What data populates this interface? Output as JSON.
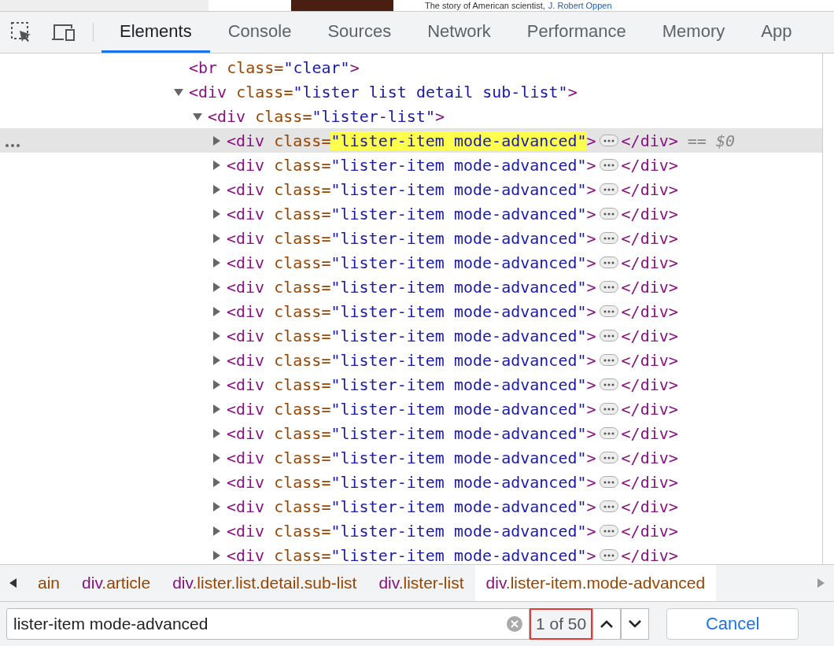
{
  "page_behind": {
    "text": "The story of American scientist,",
    "link": "J. Robert Oppen"
  },
  "tabs": [
    {
      "label": "Elements",
      "selected": true
    },
    {
      "label": "Console",
      "selected": false
    },
    {
      "label": "Sources",
      "selected": false
    },
    {
      "label": "Network",
      "selected": false
    },
    {
      "label": "Performance",
      "selected": false
    },
    {
      "label": "Memory",
      "selected": false
    },
    {
      "label": "App",
      "selected": false
    }
  ],
  "tree": [
    {
      "open": "<br",
      "attr_name": "class=",
      "attr_value": "\"clear\"",
      "tag_end": ">",
      "expanded": false,
      "selected": false,
      "highlighted": false
    },
    {
      "open": "<div",
      "attr_name": "class=",
      "attr_value": "\"lister list detail sub-list\"",
      "tag_end": ">",
      "expanded": true,
      "selected": false,
      "highlighted": false,
      "children": [
        {
          "open": "<div",
          "attr_name": "class=",
          "attr_value": "\"lister-list\"",
          "tag_end": ">",
          "expanded": true,
          "selected": false,
          "highlighted": false,
          "children": [
            {
              "open": "<div",
              "attr_name": "class=",
              "attr_value": "\"lister-item mode-advanced\"",
              "tag_end": ">",
              "close": "</div>",
              "marker": "== $0",
              "expanded": false,
              "selected": true,
              "highlighted": true
            },
            {
              "open": "<div",
              "attr_name": "class=",
              "attr_value": "\"lister-item mode-advanced\"",
              "tag_end": ">",
              "close": "</div>",
              "expanded": false,
              "selected": false,
              "highlighted": false
            },
            {
              "open": "<div",
              "attr_name": "class=",
              "attr_value": "\"lister-item mode-advanced\"",
              "tag_end": ">",
              "close": "</div>",
              "expanded": false,
              "selected": false,
              "highlighted": false
            },
            {
              "open": "<div",
              "attr_name": "class=",
              "attr_value": "\"lister-item mode-advanced\"",
              "tag_end": ">",
              "close": "</div>",
              "expanded": false,
              "selected": false,
              "highlighted": false
            },
            {
              "open": "<div",
              "attr_name": "class=",
              "attr_value": "\"lister-item mode-advanced\"",
              "tag_end": ">",
              "close": "</div>",
              "expanded": false,
              "selected": false,
              "highlighted": false
            },
            {
              "open": "<div",
              "attr_name": "class=",
              "attr_value": "\"lister-item mode-advanced\"",
              "tag_end": ">",
              "close": "</div>",
              "expanded": false,
              "selected": false,
              "highlighted": false
            },
            {
              "open": "<div",
              "attr_name": "class=",
              "attr_value": "\"lister-item mode-advanced\"",
              "tag_end": ">",
              "close": "</div>",
              "expanded": false,
              "selected": false,
              "highlighted": false
            },
            {
              "open": "<div",
              "attr_name": "class=",
              "attr_value": "\"lister-item mode-advanced\"",
              "tag_end": ">",
              "close": "</div>",
              "expanded": false,
              "selected": false,
              "highlighted": false
            },
            {
              "open": "<div",
              "attr_name": "class=",
              "attr_value": "\"lister-item mode-advanced\"",
              "tag_end": ">",
              "close": "</div>",
              "expanded": false,
              "selected": false,
              "highlighted": false
            },
            {
              "open": "<div",
              "attr_name": "class=",
              "attr_value": "\"lister-item mode-advanced\"",
              "tag_end": ">",
              "close": "</div>",
              "expanded": false,
              "selected": false,
              "highlighted": false
            },
            {
              "open": "<div",
              "attr_name": "class=",
              "attr_value": "\"lister-item mode-advanced\"",
              "tag_end": ">",
              "close": "</div>",
              "expanded": false,
              "selected": false,
              "highlighted": false
            },
            {
              "open": "<div",
              "attr_name": "class=",
              "attr_value": "\"lister-item mode-advanced\"",
              "tag_end": ">",
              "close": "</div>",
              "expanded": false,
              "selected": false,
              "highlighted": false
            },
            {
              "open": "<div",
              "attr_name": "class=",
              "attr_value": "\"lister-item mode-advanced\"",
              "tag_end": ">",
              "close": "</div>",
              "expanded": false,
              "selected": false,
              "highlighted": false
            },
            {
              "open": "<div",
              "attr_name": "class=",
              "attr_value": "\"lister-item mode-advanced\"",
              "tag_end": ">",
              "close": "</div>",
              "expanded": false,
              "selected": false,
              "highlighted": false
            },
            {
              "open": "<div",
              "attr_name": "class=",
              "attr_value": "\"lister-item mode-advanced\"",
              "tag_end": ">",
              "close": "</div>",
              "expanded": false,
              "selected": false,
              "highlighted": false
            },
            {
              "open": "<div",
              "attr_name": "class=",
              "attr_value": "\"lister-item mode-advanced\"",
              "tag_end": ">",
              "close": "</div>",
              "expanded": false,
              "selected": false,
              "highlighted": false
            },
            {
              "open": "<div",
              "attr_name": "class=",
              "attr_value": "\"lister-item mode-advanced\"",
              "tag_end": ">",
              "close": "</div>",
              "expanded": false,
              "selected": false,
              "highlighted": false
            },
            {
              "open": "<div",
              "attr_name": "class=",
              "attr_value": "\"lister-item mode-advanced\"",
              "tag_end": ">",
              "close": "</div>",
              "expanded": false,
              "selected": false,
              "highlighted": false
            }
          ]
        }
      ]
    }
  ],
  "breadcrumbs": [
    {
      "classes": "ain",
      "selected": false
    },
    {
      "tag": "div",
      "classes": ".article",
      "selected": false
    },
    {
      "tag": "div",
      "classes": ".lister.list.detail.sub-list",
      "selected": false
    },
    {
      "tag": "div",
      "classes": ".lister-list",
      "selected": false
    },
    {
      "tag": "div",
      "classes": ".lister-item.mode-advanced",
      "selected": true
    }
  ],
  "search": {
    "value": "lister-item mode-advanced",
    "count": "1 of 50",
    "cancel": "Cancel"
  }
}
